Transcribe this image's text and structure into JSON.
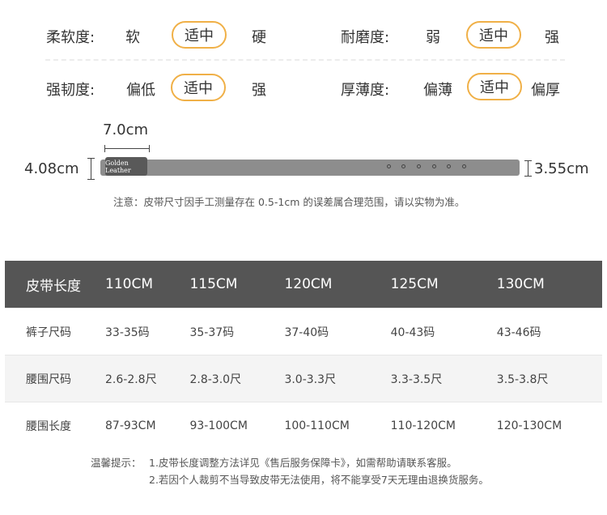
{
  "properties": [
    {
      "label": "柔软度:",
      "options": [
        "软",
        "适中",
        "硬"
      ],
      "selected": 1
    },
    {
      "label": "耐磨度:",
      "options": [
        "弱",
        "适中",
        "强"
      ],
      "selected": 1
    },
    {
      "label": "强韧度:",
      "options": [
        "偏低",
        "适中",
        "强"
      ],
      "selected": 1
    },
    {
      "label": "厚薄度:",
      "options": [
        "偏薄",
        "适中",
        "偏厚"
      ],
      "selected": 1
    }
  ],
  "diagram": {
    "buckle_width": "7.0cm",
    "left_height": "4.08cm",
    "right_height": "3.55cm",
    "buckle_logo": "Golden Leather",
    "note": "注意：皮带尺寸因手工测量存在 0.5-1cm 的误差属合理范围，请以实物为准。"
  },
  "table": {
    "header": [
      "皮带长度",
      "110CM",
      "115CM",
      "120CM",
      "125CM",
      "130CM"
    ],
    "rows": [
      [
        "裤子尺码",
        "33-35码",
        "35-37码",
        "37-40码",
        "40-43码",
        "43-46码"
      ],
      [
        "腰围尺码",
        "2.6-2.8尺",
        "2.8-3.0尺",
        "3.0-3.3尺",
        "3.3-3.5尺",
        "3.5-3.8尺"
      ],
      [
        "腰围长度",
        "87-93CM",
        "93-100CM",
        "100-110CM",
        "110-120CM",
        "120-130CM"
      ]
    ]
  },
  "tips": {
    "prefix": "温馨提示：",
    "line1": "1.皮带长度调整方法详见《售后服务保障卡》，如需帮助请联系客服。",
    "line2": "2.若因个人裁剪不当导致皮带无法使用，将不能享受7天无理由退换货服务。"
  },
  "colors": {
    "accent": "#f0b047",
    "header_bg": "#555555",
    "belt": "#8d8d8d",
    "buckle": "#595959"
  }
}
